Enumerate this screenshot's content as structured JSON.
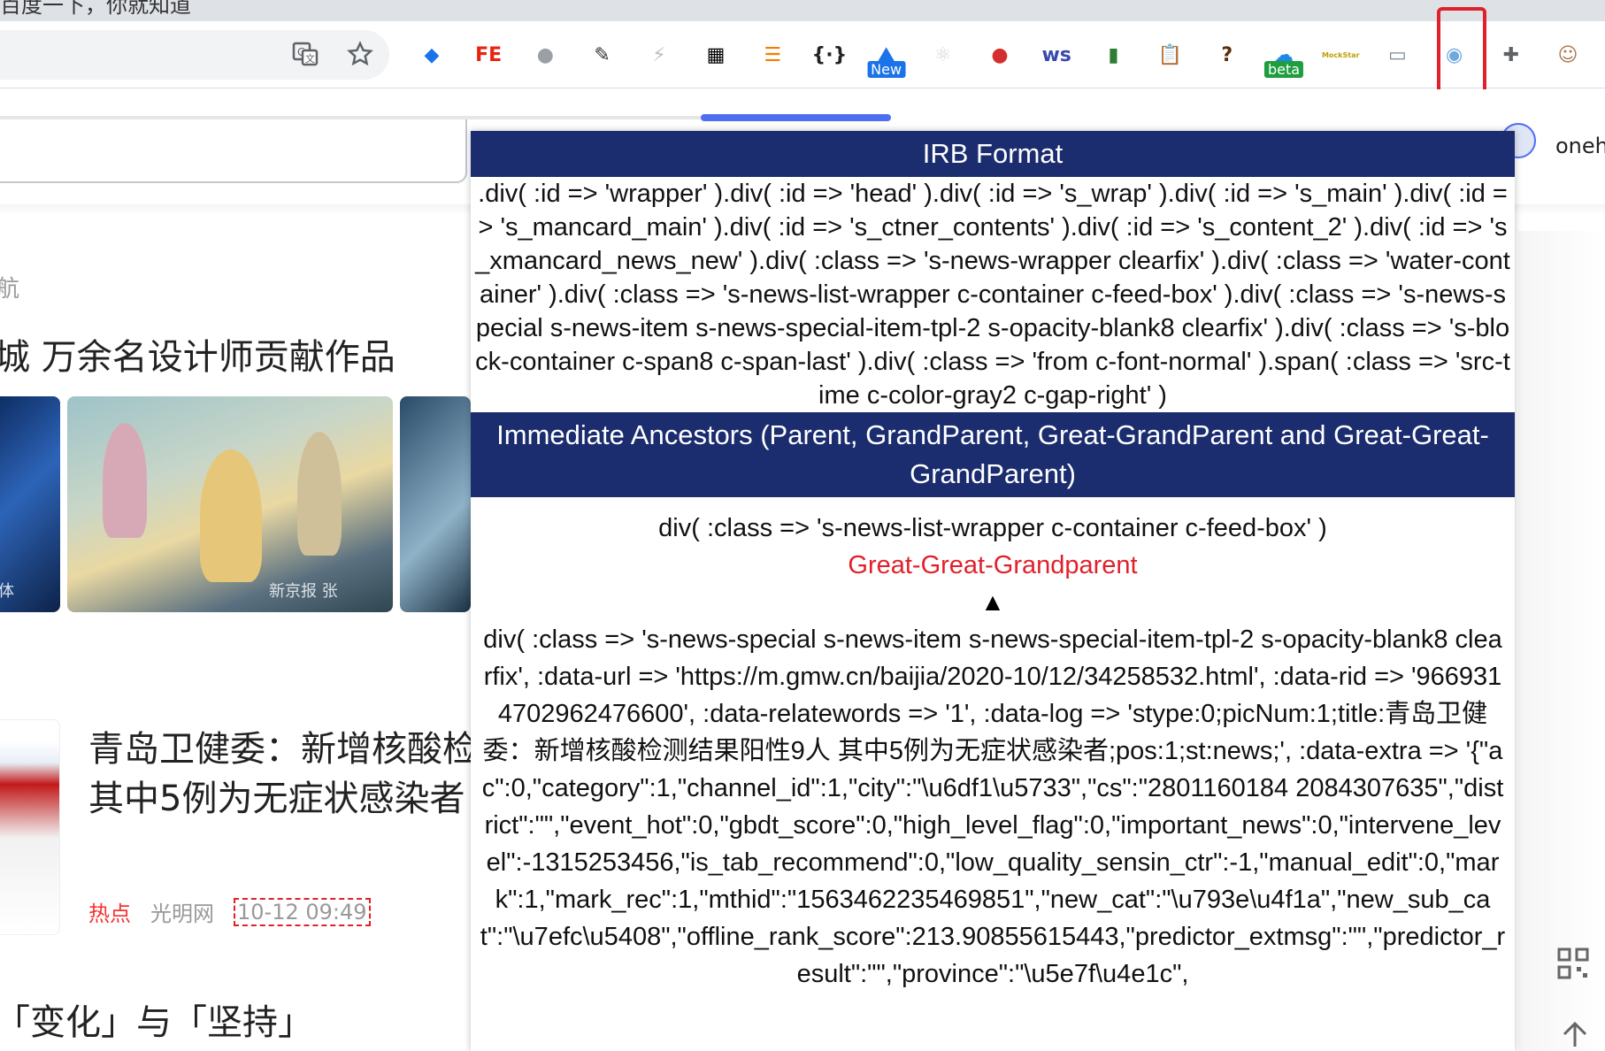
{
  "browser": {
    "tab_fragment": "百度一下，你就知道",
    "toolbar": {
      "translate_icon": "translate-icon",
      "bookmark_icon": "star-icon",
      "extensions": [
        {
          "name": "blue-diamond-extension",
          "glyph": "◆",
          "color": "#1a73e8",
          "label": ""
        },
        {
          "name": "fe-extension",
          "glyph": "FE",
          "color": "#e8230e",
          "label": ""
        },
        {
          "name": "globe-extension",
          "glyph": "●",
          "color": "#9aa0a6",
          "label": ""
        },
        {
          "name": "eyedropper-extension",
          "glyph": "✎",
          "color": "#333333",
          "label": ""
        },
        {
          "name": "lightning-extension",
          "glyph": "⚡",
          "color": "#bdbdbd",
          "label": ""
        },
        {
          "name": "qr-code-extension",
          "glyph": "▦",
          "color": "#000000",
          "label": ""
        },
        {
          "name": "stack-extension",
          "glyph": "☰",
          "color": "#f57c00",
          "label": ""
        },
        {
          "name": "json-braces-extension",
          "glyph": "{·}",
          "color": "#222222",
          "label": ""
        },
        {
          "name": "new-badge-extension",
          "glyph": "⛰",
          "color": "#1a73e8",
          "label": "New"
        },
        {
          "name": "react-atom-extension",
          "glyph": "⚛",
          "color": "#cfd8dc",
          "label": ""
        },
        {
          "name": "red-dot-extension",
          "glyph": "●",
          "color": "#d32f2f",
          "label": ""
        },
        {
          "name": "ws-extension",
          "glyph": "ws",
          "color": "#3949ab",
          "label": ""
        },
        {
          "name": "battery-extension",
          "glyph": "▮",
          "color": "#2e7d32",
          "label": ""
        },
        {
          "name": "clipboard-extension",
          "glyph": "📋",
          "color": "#f9a825",
          "label": ""
        },
        {
          "name": "question-extension",
          "glyph": "?",
          "color": "#5d2e0c",
          "label": ""
        },
        {
          "name": "beta-extension",
          "glyph": "☁",
          "color": "#1e88e5",
          "label": "beta"
        },
        {
          "name": "mockstar-extension",
          "glyph": "MockStar",
          "color": "#c0a000",
          "label": ""
        },
        {
          "name": "image-download-extension",
          "glyph": "▭",
          "color": "#7a8b99",
          "label": ""
        },
        {
          "name": "irb-locator-extension",
          "glyph": "◉",
          "color": "#6fa8dc",
          "label": ""
        },
        {
          "name": "puzzle-extensions-menu",
          "glyph": "✚",
          "color": "#5f6368",
          "label": ""
        },
        {
          "name": "profile-avatar",
          "glyph": "☺",
          "color": "#a97b50",
          "label": ""
        }
      ]
    }
  },
  "page": {
    "nav_fragment": "航",
    "headline": "城 万余名设计师贡献作品",
    "photo1_caption": "体",
    "photo2_caption": "新京报 张",
    "news": {
      "title_line1": "青岛卫健委：新增核酸检",
      "title_line2": "其中5例为无症状感染者",
      "tag": "热点",
      "source": "光明网",
      "time": "10-12 09:49"
    },
    "next_headline": "「变化」与「坚持」",
    "user_name": "oneh"
  },
  "panel": {
    "irb_header": "IRB Format",
    "irb_path": ".div( :id => 'wrapper' ).div( :id => 'head' ).div( :id => 's_wrap' ).div( :id => 's_main' ).div( :id => 's_mancard_main' ).div( :id => 's_ctner_contents' ).div( :id => 's_content_2' ).div( :id => 's_xmancard_news_new' ).div( :class => 's-news-wrapper clearfix' ).div( :class => 'water-container' ).div( :class => 's-news-list-wrapper c-container c-feed-box' ).div( :class => 's-news-special s-news-item s-news-special-item-tpl-2 s-opacity-blank8 clearfix' ).div( :class => 's-block-container c-span8 c-span-last' ).div( :class => 'from c-font-normal' ).span( :class => 'src-time c-color-gray2 c-gap-right' )",
    "ancestors_header": "Immediate Ancestors (Parent, GrandParent, Great-GrandParent and Great-Great-GrandParent)",
    "great_great_grandparent_code": "div( :class => 's-news-list-wrapper c-container c-feed-box' )",
    "great_great_grandparent_label": "Great-Great-Grandparent",
    "arrow": "▲",
    "great_grandparent_code": "div( :class => 's-news-special s-news-item s-news-special-item-tpl-2 s-opacity-blank8 clearfix', :data-url => 'https://m.gmw.cn/baijia/2020-10/12/34258532.html', :data-rid => '9669314702962476600', :data-relatewords => '1', :data-log => 'stype:0;picNum:1;title:青岛卫健委：新增核酸检测结果阳性9人 其中5例为无症状感染者;pos:1;st:news;', :data-extra => '{\"ac\":0,\"category\":1,\"channel_id\":1,\"city\":\"\\u6df1\\u5733\",\"cs\":\"2801160184 2084307635\",\"district\":\"\",\"event_hot\":0,\"gbdt_score\":0,\"high_level_flag\":0,\"important_news\":0,\"intervene_level\":-1315253456,\"is_tab_recommend\":0,\"low_quality_sensin_ctr\":-1,\"manual_edit\":0,\"mark\":1,\"mark_rec\":1,\"mthid\":\"1563462235469851\",\"new_cat\":\"\\u793e\\u4f1a\",\"new_sub_cat\":\"\\u7efc\\u5408\",\"offline_rank_score\":213.90855615443,\"predictor_extmsg\":\"\",\"predictor_result\":\"\",\"province\":\"\\u5e7f\\u4e1c\","
  },
  "colors": {
    "panel_header": "#1b2d6e",
    "label_red": "#e0212b",
    "highlight_border": "#e0212b",
    "baidu_blue": "#4e6ef2"
  }
}
